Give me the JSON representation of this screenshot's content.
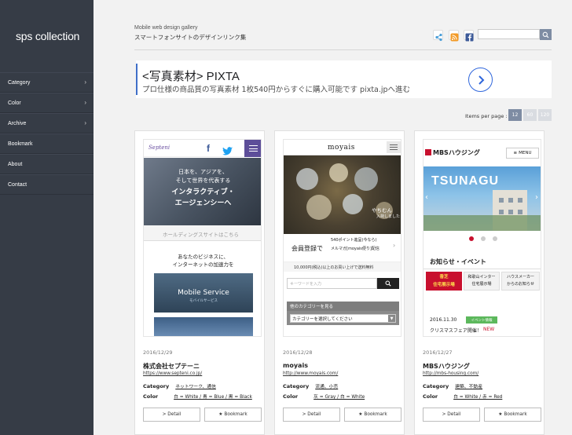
{
  "sidebar": {
    "logo": "sps collection",
    "nav": [
      {
        "label": "Category",
        "arrow": true
      },
      {
        "label": "Color",
        "arrow": true
      },
      {
        "label": "Archive",
        "arrow": true
      },
      {
        "label": "Bookmark",
        "arrow": false
      },
      {
        "label": "About",
        "arrow": false
      },
      {
        "label": "Contact",
        "arrow": false
      }
    ]
  },
  "header": {
    "subtitle": "Mobile web design gallery",
    "title": "スマートフォンサイトのデザインリンク集",
    "search_placeholder": ""
  },
  "ad": {
    "title": "<写真素材> PIXTA",
    "description": "プロ仕様の商品質の写真素材 1枚540円からすぐに購入可能です pixta.jpへ進む"
  },
  "pagination": {
    "label": "Items per page :",
    "options": [
      "12",
      "60",
      "120"
    ],
    "selected": "12"
  },
  "cards": [
    {
      "date": "2016/12/29",
      "name": "株式会社セプテーニ",
      "url": "https://www.septeni.co.jp/",
      "category_label": "Category",
      "categories": "ネットワーク、通信",
      "color_label": "Color",
      "colors": "白 = White / 青 = Blue / 黒 = Black",
      "detail_label": "> Detail",
      "bookmark_label": "★ Bookmark",
      "shot": {
        "logo": "Septeni",
        "hero_line1": "日本を、アジアを、",
        "hero_line2": "そして世界を代表する",
        "hero_line3": "インタラクティブ・",
        "hero_line4": "エージェンシーへ",
        "link": "ホールディングスサイトはこちら",
        "intro1": "あなたのビジネスに、",
        "intro2": "インターネットの加速力を",
        "service": "Mobile Service",
        "service_sub": "モバイルサービス"
      }
    },
    {
      "date": "2016/12/28",
      "name": "moyais",
      "url": "http://www.moyais.com/",
      "category_label": "Category",
      "categories": "流通、小売",
      "color_label": "Color",
      "colors": "灰 = Gray / 白 = White",
      "detail_label": "> Detail",
      "bookmark_label": "★ Bookmark",
      "shot": {
        "logo": "moyais",
        "hero_caption1": "やちむん",
        "hero_caption2": "入荷しました",
        "signup": "会員登録で",
        "point1": "540ポイント進呈(今なら)",
        "point2": "メルマガ[moyais便り]配信",
        "shipping": "10,000円(税込)以上のお買い上げで送料無料",
        "search_placeholder": "キーワードを入力",
        "cat_header": "他のカテゴリーを見る",
        "cat_select": "カテゴリーを選択してください"
      }
    },
    {
      "date": "2016/12/27",
      "name": "MBSハウジング",
      "url": "http://mbs-housing.com/",
      "category_label": "Category",
      "categories": "建築、不動産",
      "color_label": "Color",
      "colors": "白 = White / 赤 = Red",
      "detail_label": "> Detail",
      "bookmark_label": "★ Bookmark",
      "shot": {
        "logo": "MBSハウジング",
        "menu": "MENU",
        "hero": "TSUNAGU",
        "section": "お知らせ・イベント",
        "tab1_line1": "香芝",
        "tab1_line2": "住宅展示場",
        "tab2_line1": "和歌山インター",
        "tab2_line2": "住宅展示場",
        "tab3_line1": "ハウスメーカー",
        "tab3_line2": "からのお知らせ",
        "news_date": "2016.11.30",
        "news_badge": "イベント情報",
        "news_title": "クリスマスフェア開催！",
        "news_new": "NEW"
      }
    }
  ],
  "colors": {
    "sidebar_bg": "#363c46",
    "accent": "#7e8ca3",
    "ad_link": "#2f66db"
  }
}
